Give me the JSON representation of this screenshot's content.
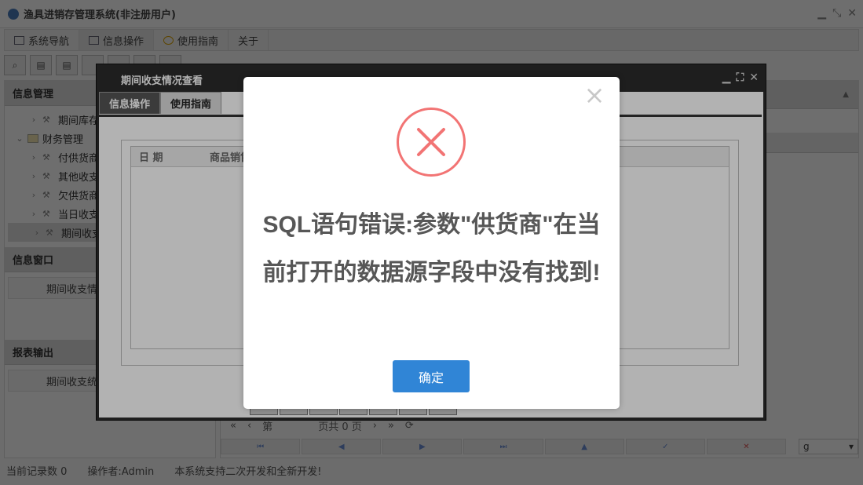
{
  "app": {
    "title": "渔具进销存管理系统(非注册用户)"
  },
  "menubar": {
    "tabs": [
      "系统导航",
      "信息操作",
      "使用指南",
      "关于"
    ]
  },
  "sidebar": {
    "info_mgmt_title": "信息管理",
    "tree": {
      "item_inventory": "期间库存",
      "finance_folder": "财务管理",
      "item_pay_supplier": "付供货商",
      "item_other_income": "其他收支",
      "item_owe_supplier": "欠供货商",
      "item_daily_income": "当日收支",
      "item_period_income": "期间收支"
    },
    "info_window_title": "信息窗口",
    "info_window_item": "期间收支情",
    "report_title": "报表输出",
    "report_item": "期间收支统"
  },
  "content": {
    "pager": {
      "first_label": "第",
      "total_label": "页共 0 页"
    },
    "combo_value": "g"
  },
  "statusbar": {
    "record_count": "当前记录数 0",
    "operator": "操作者:Admin",
    "notice": "本系统支持二次开发和全新开发!"
  },
  "inner_window": {
    "title": "期间收支情况查看",
    "tabs": [
      "信息操作",
      "使用指南"
    ],
    "grid_columns": [
      "日 期",
      "商品销售"
    ]
  },
  "dialog": {
    "message": "SQL语句错误:参数\"供货商\"在当前打开的数据源字段中没有找到!",
    "confirm_label": "确定",
    "error_color": "#f27474",
    "button_color": "#3085d6"
  }
}
